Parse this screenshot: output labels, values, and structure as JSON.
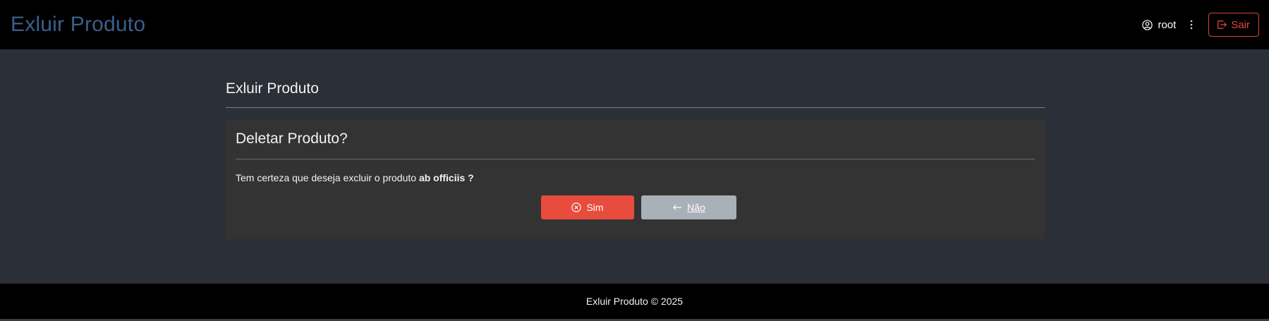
{
  "header": {
    "brand": "Exluir Produto",
    "user_name": "root",
    "logout_label": "Sair"
  },
  "main": {
    "page_heading": "Exluir Produto",
    "card_title": "Deletar Produto?",
    "question_prefix": "Tem certeza que deseja excluir o produto ",
    "product_name": "ab officiis ?",
    "yes_label": "Sim",
    "no_label": "Não"
  },
  "footer": {
    "text": "Exluir Produto © 2025"
  },
  "colors": {
    "brand": "#3a5f8c",
    "danger": "#e74c3c",
    "secondary": "#a9b0b8",
    "background": "#2b2f37",
    "card": "#333333",
    "navbar": "#000000"
  },
  "icons": {
    "user": "user-circle-icon",
    "menu": "kebab-menu-icon",
    "logout": "logout-icon",
    "yes": "x-circle-icon",
    "no": "arrow-left-icon"
  }
}
